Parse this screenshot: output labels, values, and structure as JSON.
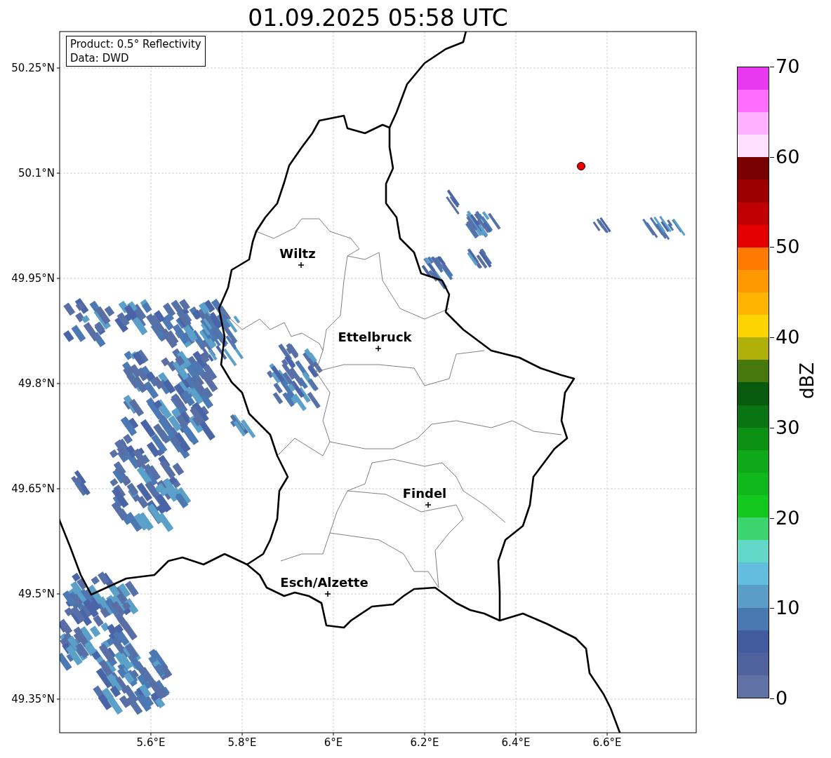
{
  "title": "01.09.2025 05:58 UTC",
  "info_box": [
    "Product: 0.5° Reflectivity",
    "Data: DWD"
  ],
  "y_ticks": [
    "50.25°N",
    "50.1°N",
    "49.95°N",
    "49.8°N",
    "49.65°N",
    "49.5°N",
    "49.35°N"
  ],
  "x_ticks": [
    "5.6°E",
    "5.8°E",
    "6°E",
    "6.2°E",
    "6.4°E",
    "6.6°E"
  ],
  "cities": [
    {
      "name": "Wiltz"
    },
    {
      "name": "Ettelbruck"
    },
    {
      "name": "Findel"
    },
    {
      "name": "Esch/Alzette"
    }
  ],
  "colorbar": {
    "label": "dBZ",
    "ticks": [
      "70",
      "60",
      "50",
      "40",
      "30",
      "20",
      "10",
      "0"
    ],
    "segments": [
      {
        "color": "#6071a6"
      },
      {
        "color": "#50629e"
      },
      {
        "color": "#435ca0"
      },
      {
        "color": "#4a78b0"
      },
      {
        "color": "#5a9ec8"
      },
      {
        "color": "#62bedc"
      },
      {
        "color": "#62d8c8"
      },
      {
        "color": "#3cd46e"
      },
      {
        "color": "#12c81e"
      },
      {
        "color": "#10b81c"
      },
      {
        "color": "#0ea818"
      },
      {
        "color": "#0c9014"
      },
      {
        "color": "#0b7412"
      },
      {
        "color": "#085a0e"
      },
      {
        "color": "#46780c"
      },
      {
        "color": "#b0b00a"
      },
      {
        "color": "#fed400"
      },
      {
        "color": "#feb400"
      },
      {
        "color": "#fe9800"
      },
      {
        "color": "#fe7a00"
      },
      {
        "color": "#e40000"
      },
      {
        "color": "#c00000"
      },
      {
        "color": "#9c0000"
      },
      {
        "color": "#780000"
      },
      {
        "color": "#ffe0ff"
      },
      {
        "color": "#ffb0ff"
      },
      {
        "color": "#ff6eff"
      },
      {
        "color": "#e838f0"
      }
    ]
  }
}
